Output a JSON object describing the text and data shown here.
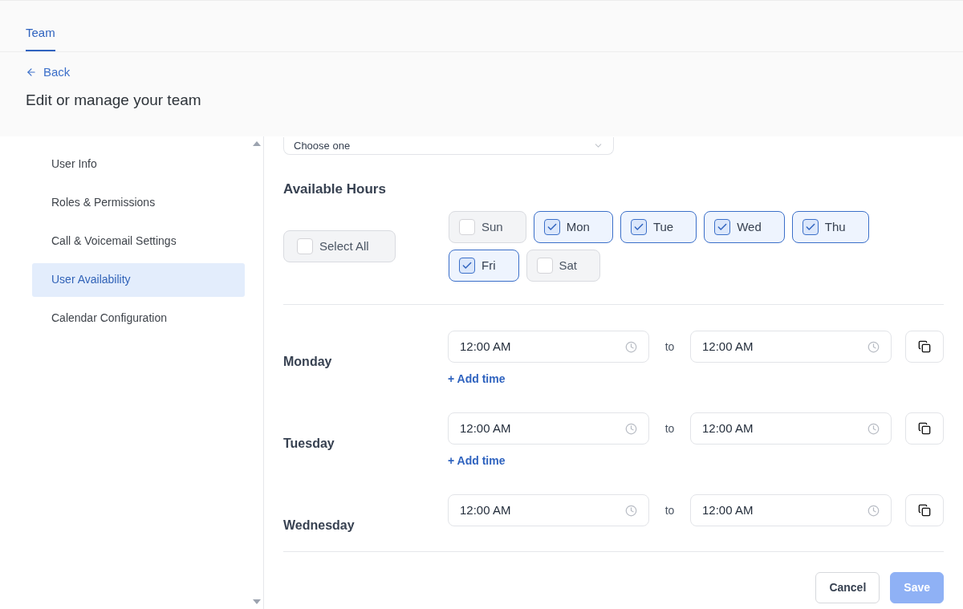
{
  "tabs": [
    {
      "label": "Team",
      "selected": true
    }
  ],
  "back": "Back",
  "title": "Edit or manage your team",
  "sidebar": {
    "items": [
      {
        "label": "User Info",
        "selected": false
      },
      {
        "label": "Roles & Permissions",
        "selected": false
      },
      {
        "label": "Call & Voicemail Settings",
        "selected": false
      },
      {
        "label": "User Availability",
        "selected": true
      },
      {
        "label": "Calendar Configuration",
        "selected": false
      }
    ]
  },
  "role_select": {
    "value": "Choose one"
  },
  "available_hours": {
    "heading": "Available Hours",
    "select_all": {
      "label": "Select All",
      "checked": false
    },
    "days": [
      {
        "label": "Sun",
        "checked": false
      },
      {
        "label": "Mon",
        "checked": true
      },
      {
        "label": "Tue",
        "checked": true
      },
      {
        "label": "Wed",
        "checked": true
      },
      {
        "label": "Thu",
        "checked": true
      },
      {
        "label": "Fri",
        "checked": true
      },
      {
        "label": "Sat",
        "checked": false
      }
    ]
  },
  "schedule": [
    {
      "day": "Monday",
      "slots": [
        {
          "start": "12:00 AM",
          "separator": "to",
          "end": "12:00 AM"
        }
      ],
      "add_time": "+ Add time"
    },
    {
      "day": "Tuesday",
      "slots": [
        {
          "start": "12:00 AM",
          "separator": "to",
          "end": "12:00 AM"
        }
      ],
      "add_time": "+ Add time"
    },
    {
      "day": "Wednesday",
      "slots": [
        {
          "start": "12:00 AM",
          "separator": "to",
          "end": "12:00 AM"
        }
      ]
    }
  ],
  "footer": {
    "buttons": [
      {
        "label": "Cancel",
        "kind": "secondary",
        "disabled": false
      },
      {
        "label": "Save",
        "kind": "primary",
        "disabled": true
      }
    ]
  }
}
